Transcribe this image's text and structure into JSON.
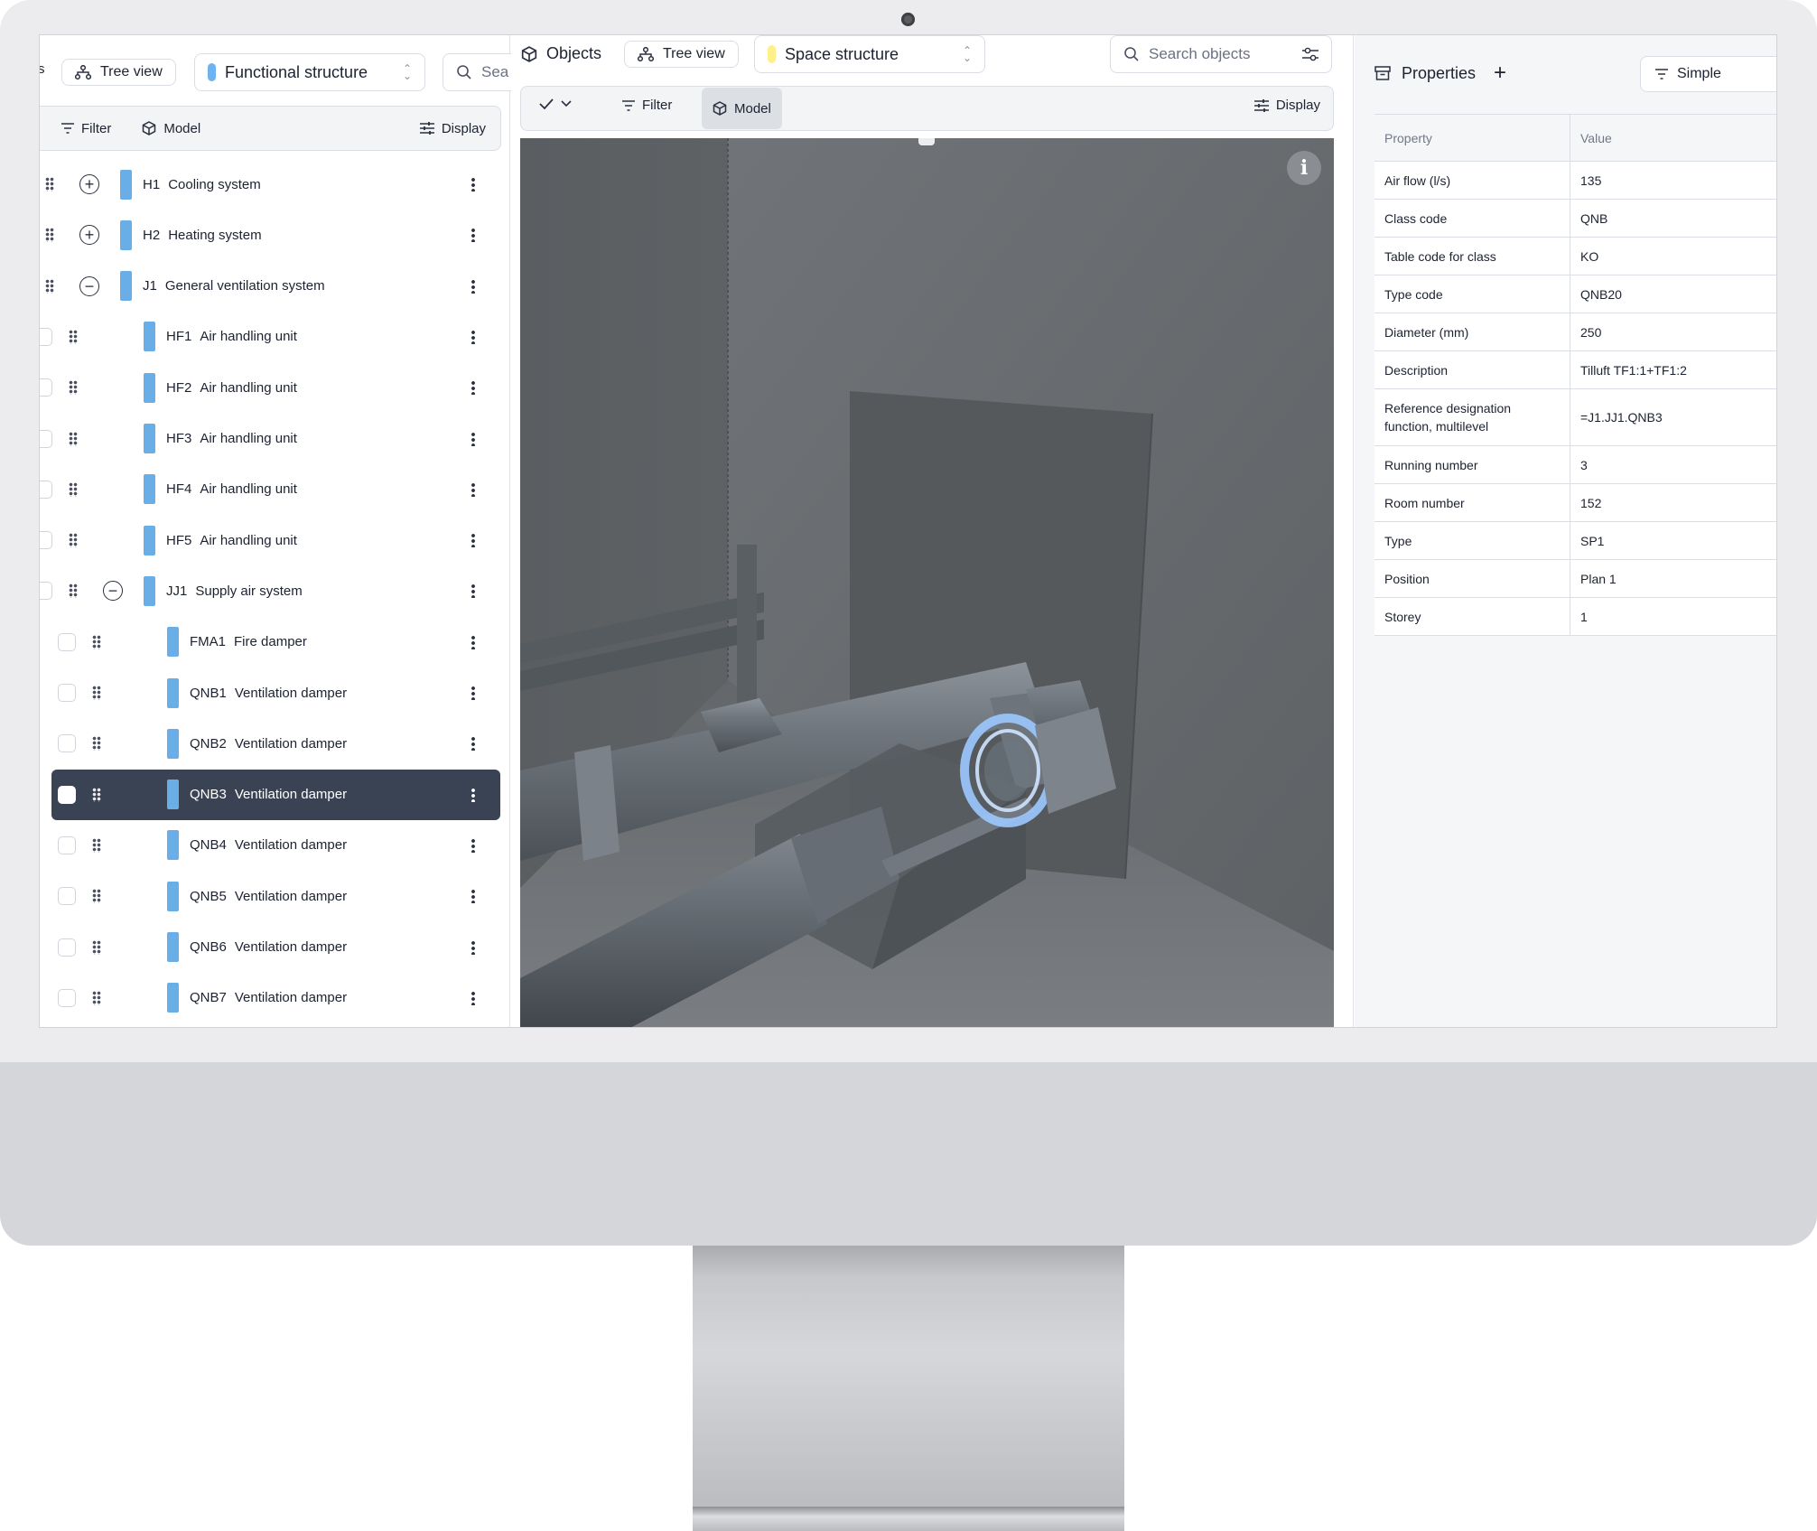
{
  "left_panel": {
    "tree_view_label": "Tree view",
    "structure_select": "Functional structure",
    "search_label": "Sea",
    "toolbar": {
      "filter": "Filter",
      "model": "Model",
      "display": "Display"
    },
    "rows": [
      {
        "code": "H1",
        "name": "Cooling system"
      },
      {
        "code": "H2",
        "name": "Heating system"
      },
      {
        "code": "J1",
        "name": "General ventilation system"
      },
      {
        "code": "HF1",
        "name": "Air handling unit"
      },
      {
        "code": "HF2",
        "name": "Air handling unit"
      },
      {
        "code": "HF3",
        "name": "Air handling unit"
      },
      {
        "code": "HF4",
        "name": "Air handling unit"
      },
      {
        "code": "HF5",
        "name": "Air handling unit"
      },
      {
        "code": "JJ1",
        "name": "Supply air system"
      },
      {
        "code": "FMA1",
        "name": "Fire damper"
      },
      {
        "code": "QNB1",
        "name": "Ventilation damper"
      },
      {
        "code": "QNB2",
        "name": "Ventilation damper"
      },
      {
        "code": "QNB3",
        "name": "Ventilation damper"
      },
      {
        "code": "QNB4",
        "name": "Ventilation damper"
      },
      {
        "code": "QNB5",
        "name": "Ventilation damper"
      },
      {
        "code": "QNB6",
        "name": "Ventilation damper"
      },
      {
        "code": "QNB7",
        "name": "Ventilation damper"
      }
    ]
  },
  "middle_panel": {
    "title": "Objects",
    "tree_view_label": "Tree view",
    "structure_select": "Space structure",
    "search_placeholder": "Search objects",
    "toolbar": {
      "filter": "Filter",
      "model": "Model",
      "display": "Display"
    },
    "info_label": "i",
    "handle_label": "..."
  },
  "right_panel": {
    "title": "Properties",
    "add_label": "+",
    "mode_label": "Simple",
    "table_headers": {
      "property": "Property",
      "value": "Value"
    },
    "properties": [
      {
        "key": "Air flow (l/s)",
        "value": "135"
      },
      {
        "key": "Class code",
        "value": "QNB"
      },
      {
        "key": "Table code for class",
        "value": "KO"
      },
      {
        "key": "Type code",
        "value": "QNB20"
      },
      {
        "key": "Diameter (mm)",
        "value": "250"
      },
      {
        "key": "Description",
        "value": "Tilluft TF1:1+TF1:2"
      },
      {
        "key": "Reference designation function, multilevel",
        "value": "=J1.JJ1.QNB3"
      },
      {
        "key": "Running number",
        "value": "3"
      },
      {
        "key": "Room number",
        "value": "152"
      },
      {
        "key": "Type",
        "value": "SP1"
      },
      {
        "key": "Position",
        "value": "Plan 1"
      },
      {
        "key": "Storey",
        "value": "1"
      }
    ]
  },
  "colors": {
    "selected_row": "#3a4354",
    "tree_tag_blue": "#6aaee8",
    "space_tag_yellow": "#fff08a",
    "selection_highlight": "#9cc8ff"
  }
}
